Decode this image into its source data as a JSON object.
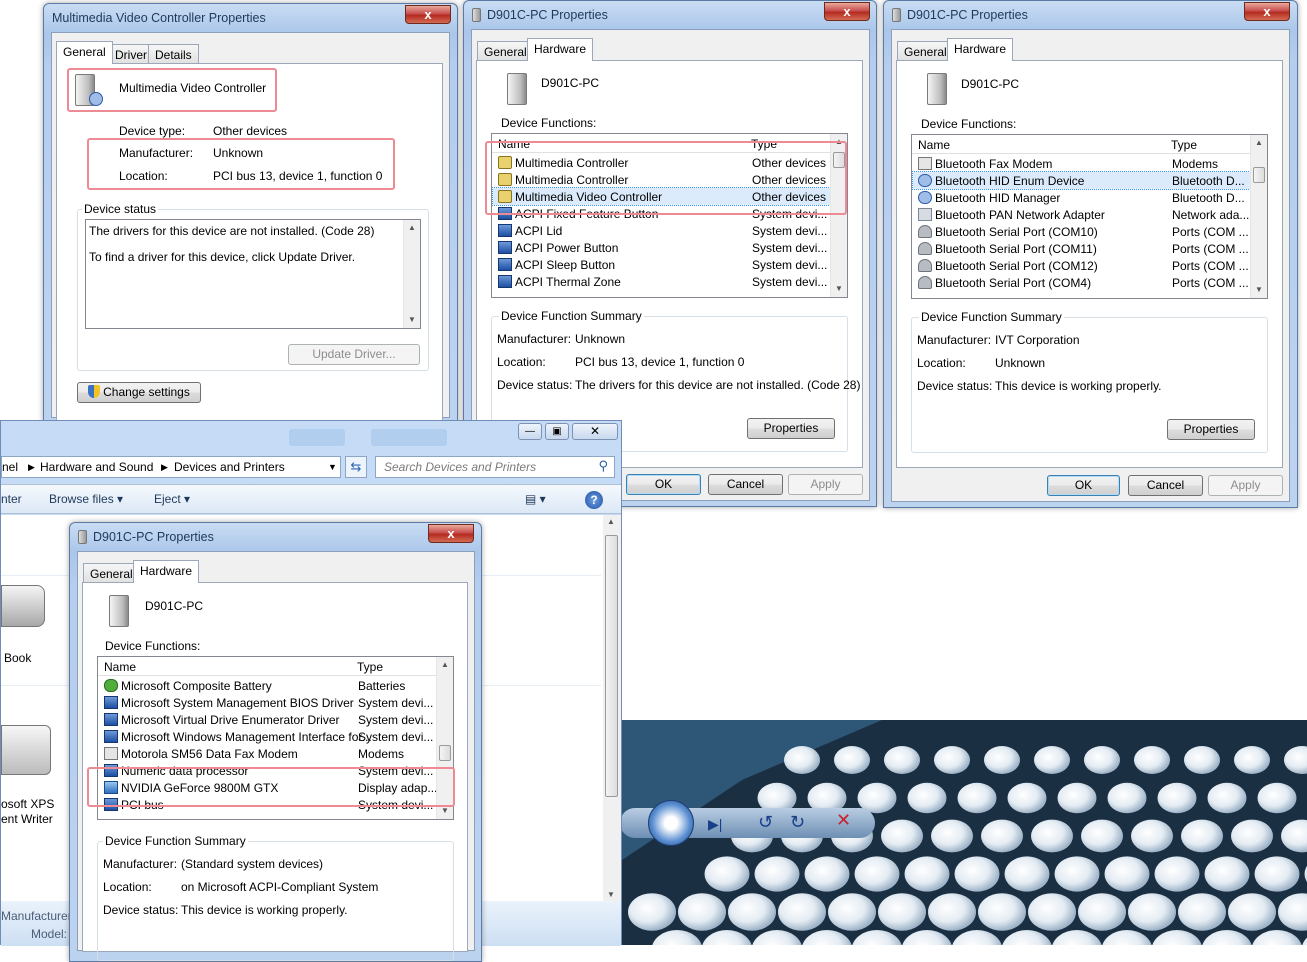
{
  "dialog_mvc": {
    "title": "Multimedia Video Controller Properties",
    "close_glyph": "x",
    "tabs": [
      "General",
      "Driver",
      "Details"
    ],
    "device_name": "Multimedia Video Controller",
    "device_type_label": "Device type:",
    "device_type_value": "Other devices",
    "manufacturer_label": "Manufacturer:",
    "manufacturer_value": "Unknown",
    "location_label": "Location:",
    "location_value": "PCI bus 13, device 1, function 0",
    "status_group": "Device status",
    "status_line1": "The drivers for this device are not installed. (Code 28)",
    "status_line2": "To find a driver for this device, click Update Driver.",
    "update_driver_button": "Update Driver...",
    "change_settings_button": "Change settings"
  },
  "dialog_hw1": {
    "title": "D901C-PC Properties",
    "close_glyph": "x",
    "tabs": [
      "General",
      "Hardware"
    ],
    "device_name": "D901C-PC",
    "functions_label": "Device Functions:",
    "col_name": "Name",
    "col_type": "Type",
    "rows": [
      {
        "name": "Multimedia Controller",
        "type": "Other devices",
        "icon": "warning-device-icon"
      },
      {
        "name": "Multimedia Controller",
        "type": "Other devices",
        "icon": "warning-device-icon"
      },
      {
        "name": "Multimedia Video Controller",
        "type": "Other devices",
        "icon": "warning-device-icon"
      },
      {
        "name": "ACPI Fixed Feature Button",
        "type": "System devi...",
        "icon": "system-device-icon"
      },
      {
        "name": "ACPI Lid",
        "type": "System devi...",
        "icon": "system-device-icon"
      },
      {
        "name": "ACPI Power Button",
        "type": "System devi...",
        "icon": "system-device-icon"
      },
      {
        "name": "ACPI Sleep Button",
        "type": "System devi...",
        "icon": "system-device-icon"
      },
      {
        "name": "ACPI Thermal Zone",
        "type": "System devi...",
        "icon": "system-device-icon"
      }
    ],
    "summary_group": "Device Function Summary",
    "manufacturer_label": "Manufacturer:",
    "manufacturer_value": "Unknown",
    "location_label": "Location:",
    "location_value": "PCI bus 13, device 1, function 0",
    "status_label": "Device status:",
    "status_value": "The drivers for this device are not installed. (Code 28)",
    "properties_button": "Properties",
    "ok_button": "OK",
    "cancel_button": "Cancel",
    "apply_button": "Apply"
  },
  "dialog_hw2": {
    "title": "D901C-PC Properties",
    "close_glyph": "x",
    "tabs": [
      "General",
      "Hardware"
    ],
    "device_name": "D901C-PC",
    "functions_label": "Device Functions:",
    "col_name": "Name",
    "col_type": "Type",
    "rows": [
      {
        "name": "Bluetooth Fax Modem",
        "type": "Modems",
        "icon": "modem-icon"
      },
      {
        "name": "Bluetooth HID Enum Device",
        "type": "Bluetooth D...",
        "icon": "help-device-icon"
      },
      {
        "name": "Bluetooth HID Manager",
        "type": "Bluetooth D...",
        "icon": "help-device-icon"
      },
      {
        "name": "Bluetooth PAN Network Adapter",
        "type": "Network ada...",
        "icon": "network-adapter-icon"
      },
      {
        "name": "Bluetooth Serial Port (COM10)",
        "type": "Ports (COM ...",
        "icon": "port-icon"
      },
      {
        "name": "Bluetooth Serial Port (COM11)",
        "type": "Ports (COM ...",
        "icon": "port-icon"
      },
      {
        "name": "Bluetooth Serial Port (COM12)",
        "type": "Ports (COM ...",
        "icon": "port-icon"
      },
      {
        "name": "Bluetooth Serial Port (COM4)",
        "type": "Ports (COM ...",
        "icon": "port-icon"
      }
    ],
    "summary_group": "Device Function Summary",
    "manufacturer_label": "Manufacturer:",
    "manufacturer_value": "IVT Corporation",
    "location_label": "Location:",
    "location_value": "Unknown",
    "status_label": "Device status:",
    "status_value": "This device is working properly.",
    "properties_button": "Properties",
    "ok_button": "OK",
    "cancel_button": "Cancel",
    "apply_button": "Apply"
  },
  "explorer": {
    "breadcrumb": [
      "nel",
      "Hardware and Sound",
      "Devices and Printers"
    ],
    "search_placeholder": "Search Devices and Printers",
    "toolbar": [
      "nter",
      "Browse files",
      "Eject"
    ],
    "devices": [
      {
        "label": "Book"
      },
      {
        "label": "osoft XPS"
      },
      {
        "label": "ent Writer"
      }
    ],
    "details_manufacturer_label": "Manufacturer:",
    "details_model_label": "Model:"
  },
  "dialog_hw3": {
    "title": "D901C-PC Properties",
    "close_glyph": "x",
    "tabs": [
      "General",
      "Hardware"
    ],
    "device_name": "D901C-PC",
    "functions_label": "Device Functions:",
    "col_name": "Name",
    "col_type": "Type",
    "rows": [
      {
        "name": "Microsoft Composite Battery",
        "type": "Batteries",
        "icon": "battery-icon"
      },
      {
        "name": "Microsoft System Management BIOS Driver",
        "type": "System devi...",
        "icon": "system-device-icon"
      },
      {
        "name": "Microsoft Virtual Drive Enumerator Driver",
        "type": "System devi...",
        "icon": "system-device-icon"
      },
      {
        "name": "Microsoft Windows Management Interface for...",
        "type": "System devi...",
        "icon": "system-device-icon"
      },
      {
        "name": "Motorola SM56 Data Fax Modem",
        "type": "Modems",
        "icon": "modem-icon"
      },
      {
        "name": "Numeric data processor",
        "type": "System devi...",
        "icon": "system-device-icon"
      },
      {
        "name": "NVIDIA GeForce 9800M GTX",
        "type": "Display adap...",
        "icon": "display-adapter-icon"
      },
      {
        "name": "PCI bus",
        "type": "System devi...",
        "icon": "system-device-icon"
      }
    ],
    "summary_group": "Device Function Summary",
    "manufacturer_label": "Manufacturer:",
    "manufacturer_value": "(Standard system devices)",
    "location_label": "Location:",
    "location_value": "on Microsoft ACPI-Compliant System",
    "status_label": "Device status:",
    "status_value": "This device is working properly."
  },
  "colors": {
    "highlight_box": "#ee8a93",
    "titlebar": "#b5cdee",
    "selection": "#dcebfc"
  }
}
